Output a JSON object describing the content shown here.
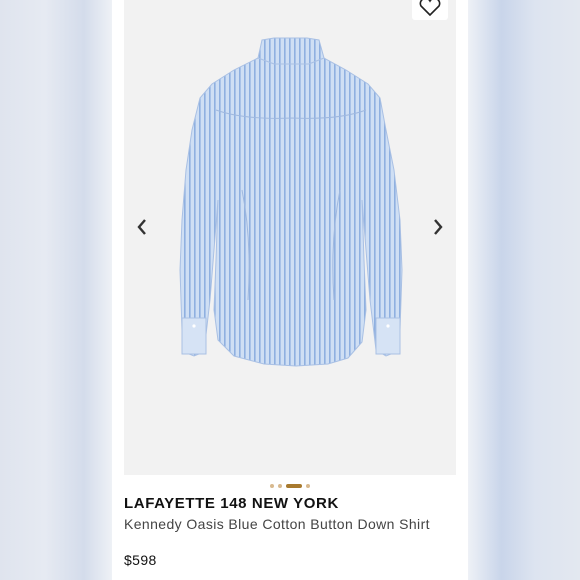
{
  "product": {
    "brand": "LAFAYETTE 148 NEW YORK",
    "name": "Kennedy Oasis Blue Cotton Button Down Shirt",
    "price": "$598"
  },
  "gallery": {
    "prev_icon": "chevron-left-icon",
    "next_icon": "chevron-right-icon",
    "wishlist_icon": "heart-outline-icon",
    "dots_count": 4,
    "active_dot": 3
  },
  "colors": {
    "accent": "#a87a2e",
    "dot_inactive": "#d8b98f",
    "shirt_base": "#c8d9f1",
    "shirt_stripe": "#8fb0e0"
  }
}
